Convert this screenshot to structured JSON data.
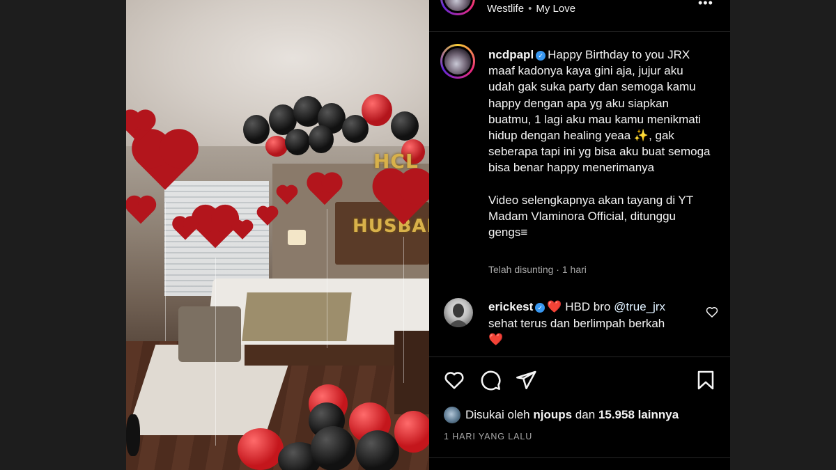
{
  "header": {
    "music_artist": "Westlife",
    "music_track": "My Love",
    "more_icon": "more-dots-icon"
  },
  "caption": {
    "username": "ncdpapl",
    "verified_icon": "verified-badge-icon",
    "paragraph1": "Happy Birthday to you JRX maaf kadonya kaya gini aja, jujur aku udah gak suka party dan semoga kamu happy dengan apa yg aku siapkan buatmu, 1 lagi aku mau kamu menikmati hidup dengan healing yeaa ✨, gak seberapa tapi ini yg bisa aku buat semoga bisa benar happy menerimanya",
    "paragraph2": "Video selengkapnya akan tayang di YT Madam Vlaminora Official, ditunggu gengs≡",
    "edited_text": "Telah disunting",
    "edited_dot": "·",
    "edited_time": "1 hari"
  },
  "comment": {
    "username": "erickest",
    "heart_emoji": "❤️",
    "text_before_mention": "HBD bro",
    "mention": "@true_jrx",
    "text_after": "sehat terus dan berlimpah berkah",
    "end_emoji": "❤️"
  },
  "actions": {
    "like_icon": "heart-outline-icon",
    "comment_icon": "comment-icon",
    "share_icon": "send-icon",
    "save_icon": "bookmark-icon"
  },
  "likes": {
    "prefix": "Disukai oleh",
    "user": "njoups",
    "connector": "dan",
    "count": "15.958 lainnya"
  },
  "timestamp": "1 HARI YANG LALU",
  "photo": {
    "balloon_letters_top": "HCL",
    "balloon_letters_mid": "HUSBAND"
  },
  "colors": {
    "panel_bg": "#000000",
    "text_primary": "#f5f5f5",
    "text_secondary": "#a8a8a8",
    "verified": "#3897f0",
    "balloon_red": "#b3151c"
  }
}
